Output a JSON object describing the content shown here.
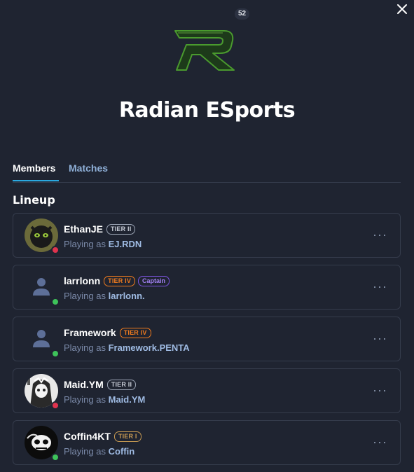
{
  "header": {
    "level_badge": "52",
    "team_name": "Radian ESports",
    "close_icon": "close-icon",
    "logo_color": "#2f7d23"
  },
  "tabs": [
    {
      "label": "Members",
      "active": true
    },
    {
      "label": "Matches",
      "active": false
    }
  ],
  "section_title": "Lineup",
  "playing_as_prefix": "Playing as",
  "colors": {
    "accent": "#2aa9e0",
    "online": "#3ec35a",
    "offline": "#e0334e",
    "tier_ii": "#9aa3b3",
    "tier_iv": "#f07b1e",
    "tier_i": "#c79a52",
    "captain": "#7c54e0"
  },
  "members": [
    {
      "name": "EthanJE",
      "tier": "TIER II",
      "captain": "",
      "ign": "EJ.RDN",
      "status": "offline",
      "avatar": "dragon-avatar"
    },
    {
      "name": "larrlonn",
      "tier": "TIER IV",
      "captain": "Captain",
      "ign": "larrlonn.",
      "status": "online",
      "avatar": "default-user-icon"
    },
    {
      "name": "Framework",
      "tier": "TIER IV",
      "captain": "",
      "ign": "Framework.PENTA",
      "status": "online",
      "avatar": "default-user-icon"
    },
    {
      "name": "Maid.YM",
      "tier": "TIER II",
      "captain": "",
      "ign": "Maid.YM",
      "status": "offline",
      "avatar": "manga-avatar"
    },
    {
      "name": "Coffin4KT",
      "tier": "TIER I",
      "captain": "",
      "ign": "Coffin",
      "status": "online",
      "avatar": "skull-avatar"
    }
  ]
}
